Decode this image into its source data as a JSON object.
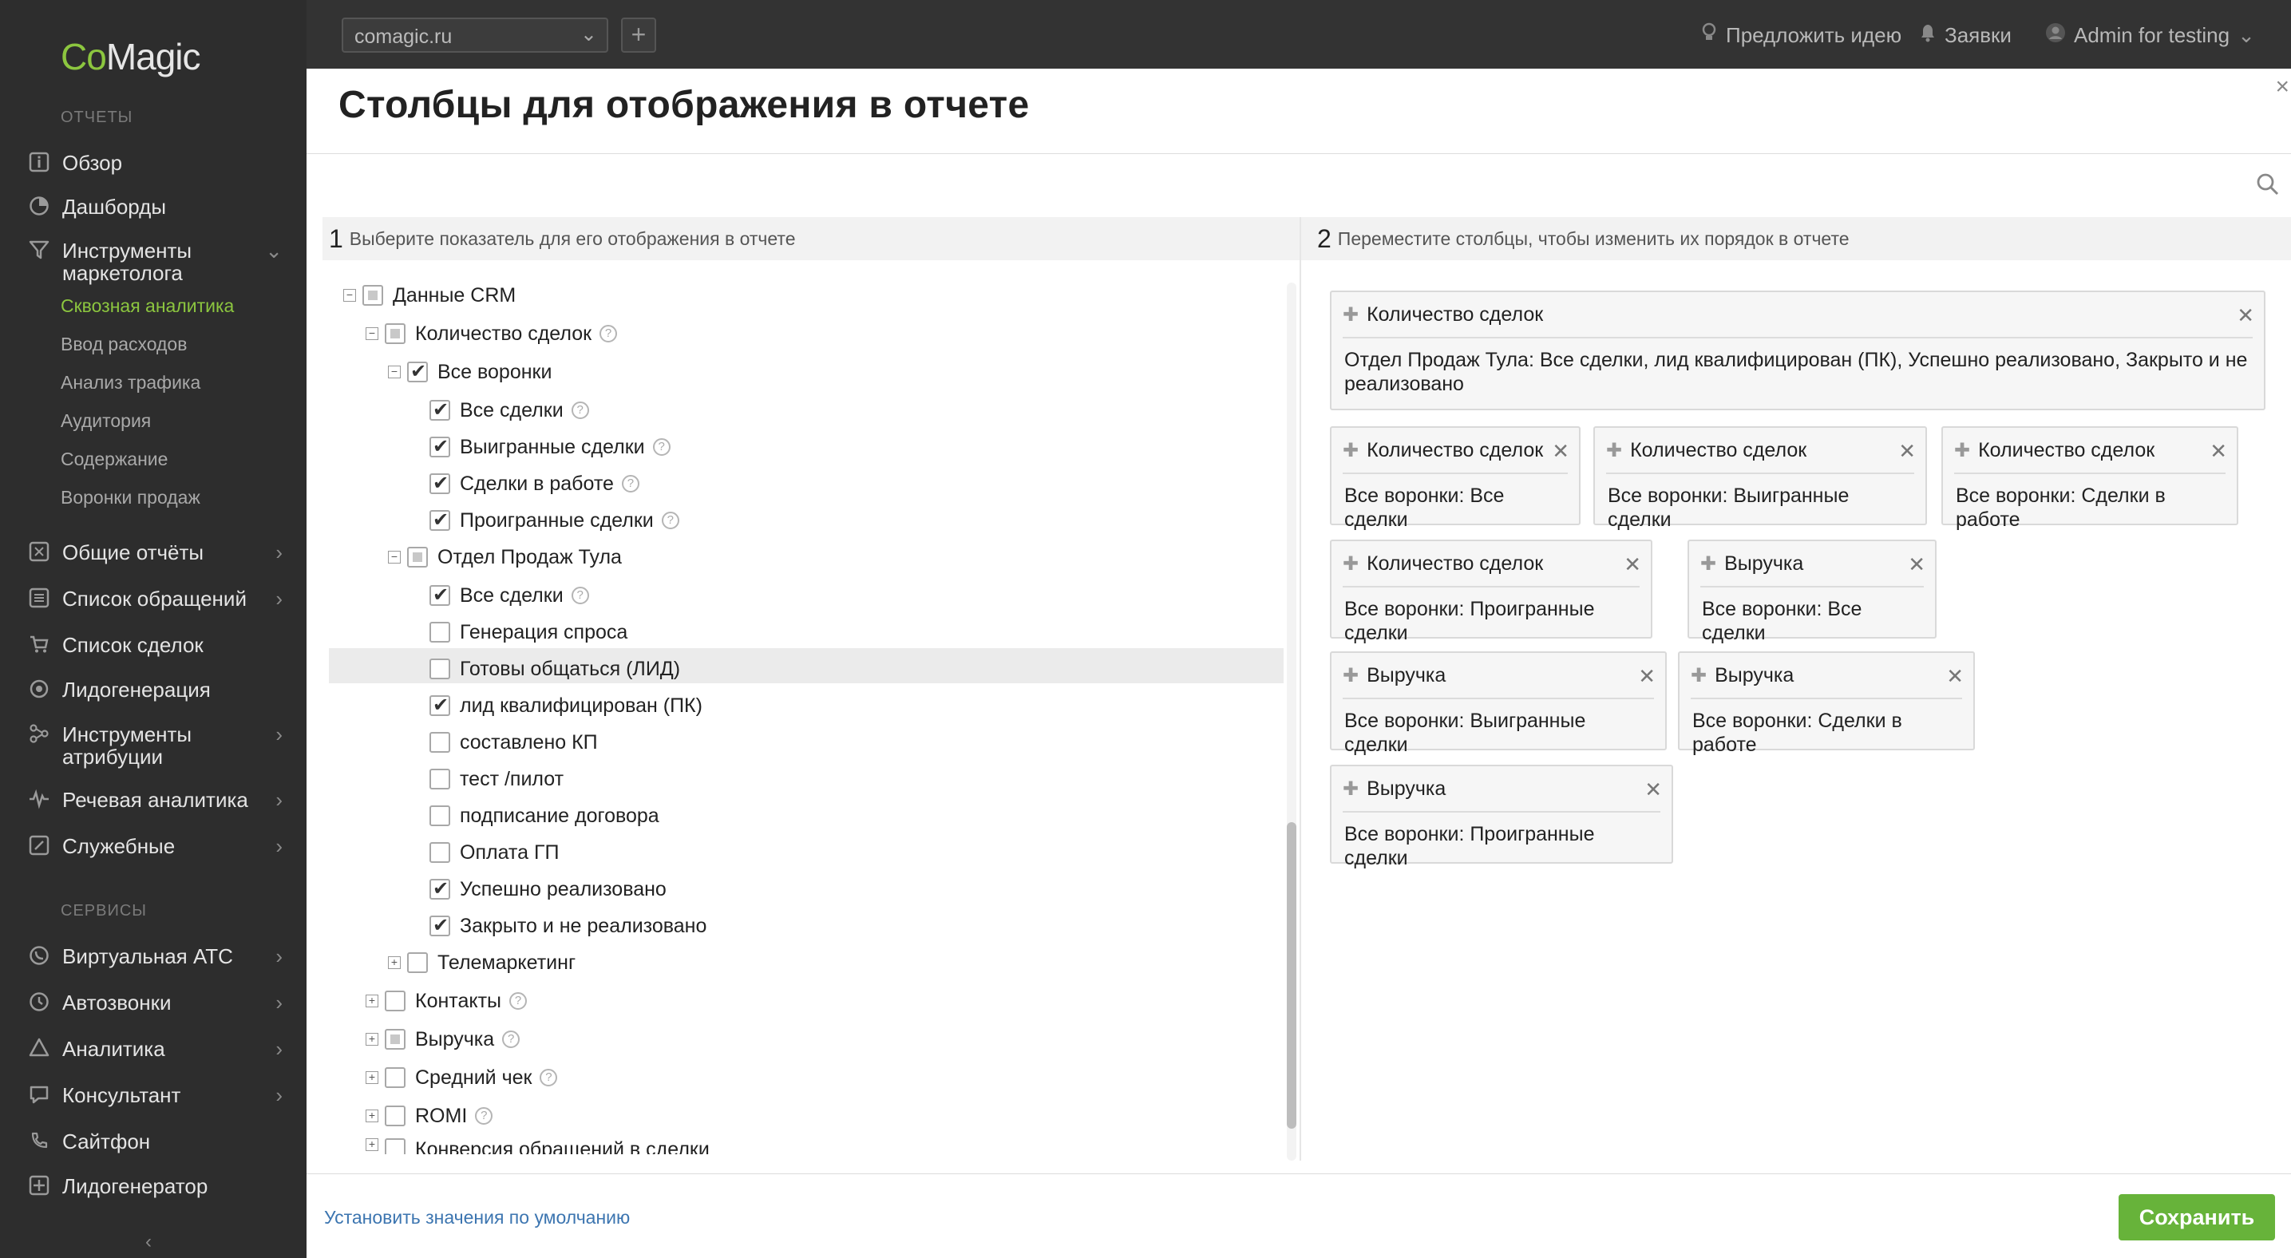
{
  "sidebar": {
    "logo_co": "Co",
    "logo_magic": "Magic",
    "section_reports": "ОТЧЕТЫ",
    "overview": "Обзор",
    "dashboards": "Дашборды",
    "marketer_tools": "Инструменты маркетолога",
    "sub_items": [
      "Сквозная аналитика",
      "Ввод расходов",
      "Анализ трафика",
      "Аудитория",
      "Содержание",
      "Воронки продаж"
    ],
    "general_reports": "Общие отчёты",
    "requests_list": "Список обращений",
    "deals_list": "Список сделок",
    "leadgen": "Лидогенерация",
    "attribution_tools": "Инструменты атрибуции",
    "speech_analytics": "Речевая аналитика",
    "service": "Служебные",
    "section_services": "СЕРВИСЫ",
    "virtual_pbx": "Виртуальная АТС",
    "autocalls": "Автозвонки",
    "analytics": "Аналитика",
    "consultant": "Консультант",
    "sitephone": "Сайтфон",
    "leadgenerator": "Лидогенератор",
    "collapse_glyph": "‹"
  },
  "topbar": {
    "site": "comagic.ru",
    "suggest_idea": "Предложить идею",
    "requests": "Заявки",
    "user": "Admin for testing"
  },
  "modal": {
    "title": "Столбцы для отображения в отчете",
    "step1_num": "1",
    "step1_text": "Выберите показатель для его отображения в отчете",
    "step2_num": "2",
    "step2_text": "Переместите столбцы, чтобы изменить их порядок в отчете",
    "reset_link": "Установить значения по умолчанию",
    "save_label": "Сохранить"
  },
  "tree": {
    "crm_data": "Данные CRM",
    "deal_count": "Количество сделок",
    "all_funnels": "Все воронки",
    "all_deals": "Все сделки",
    "won_deals": "Выигранные сделки",
    "deals_in_progress": "Сделки в работе",
    "lost_deals": "Проигранные сделки",
    "tula_dept": "Отдел Продаж Тула",
    "tula_all_deals": "Все сделки",
    "demand_gen": "Генерация спроса",
    "ready_to_talk": "Готовы общаться (ЛИД)",
    "lead_qualified": "лид квалифицирован (ПК)",
    "kp_made": "составлено КП",
    "test_pilot": "тест /пилот",
    "contract_signing": "подписание договора",
    "gp_payment": "Оплата ГП",
    "success": "Успешно реализовано",
    "closed_failed": "Закрыто и не реализовано",
    "telemarketing": "Телемаркетинг",
    "contacts": "Контакты",
    "revenue": "Выручка",
    "avg_check": "Средний чек",
    "romi": "ROMI",
    "cut_off": "Конверсия обращений в сделки"
  },
  "cards": [
    {
      "title": "Количество сделок",
      "body": "Отдел Продаж Тула: Все сделки, лид квалифицирован (ПК), Успешно реализовано, Закрыто и не реализовано"
    },
    {
      "title": "Количество сделок",
      "body": "Все воронки: Все сделки"
    },
    {
      "title": "Количество сделок",
      "body": "Все воронки: Выигранные сделки"
    },
    {
      "title": "Количество сделок",
      "body": "Все воронки: Сделки в работе"
    },
    {
      "title": "Количество сделок",
      "body": "Все воронки: Проигранные сделки"
    },
    {
      "title": "Выручка",
      "body": "Все воронки: Все сделки"
    },
    {
      "title": "Выручка",
      "body": "Все воронки: Выигранные сделки"
    },
    {
      "title": "Выручка",
      "body": "Все воронки: Сделки в работе"
    },
    {
      "title": "Выручка",
      "body": "Все воронки: Проигранные сделки"
    }
  ],
  "colors": {
    "accent_green": "#8cc63f",
    "save_green": "#67b33a",
    "link_blue": "#3c75b0",
    "sidebar_bg": "#2d2d2d",
    "topbar_bg": "#333333"
  }
}
